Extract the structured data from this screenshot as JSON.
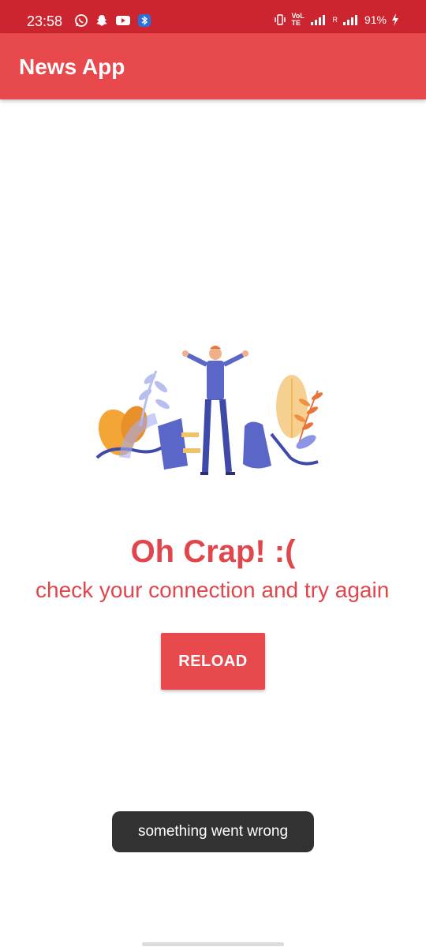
{
  "status_bar": {
    "time": "23:58",
    "notification_icons": [
      "whatsapp-icon",
      "snapchat-icon",
      "youtube-icon",
      "bluetooth-icon"
    ],
    "system_icons": [
      "vibrate-icon",
      "volte-icon",
      "signal-icon",
      "roaming-signal-icon",
      "charging-icon"
    ],
    "network_label": "VoLTE",
    "roaming_label": "R",
    "battery": "91%"
  },
  "app_bar": {
    "title": "News App"
  },
  "error": {
    "illustration": "disconnected-plug-illustration",
    "title": "Oh Crap! :(",
    "message": "check your connection and try again",
    "reload_label": "RELOAD"
  },
  "toast": {
    "text": "something went wrong"
  },
  "colors": {
    "status_bar": "#cc2530",
    "app_bar": "#e8494d",
    "accent_text": "#e0464c",
    "toast_bg": "#323232"
  }
}
